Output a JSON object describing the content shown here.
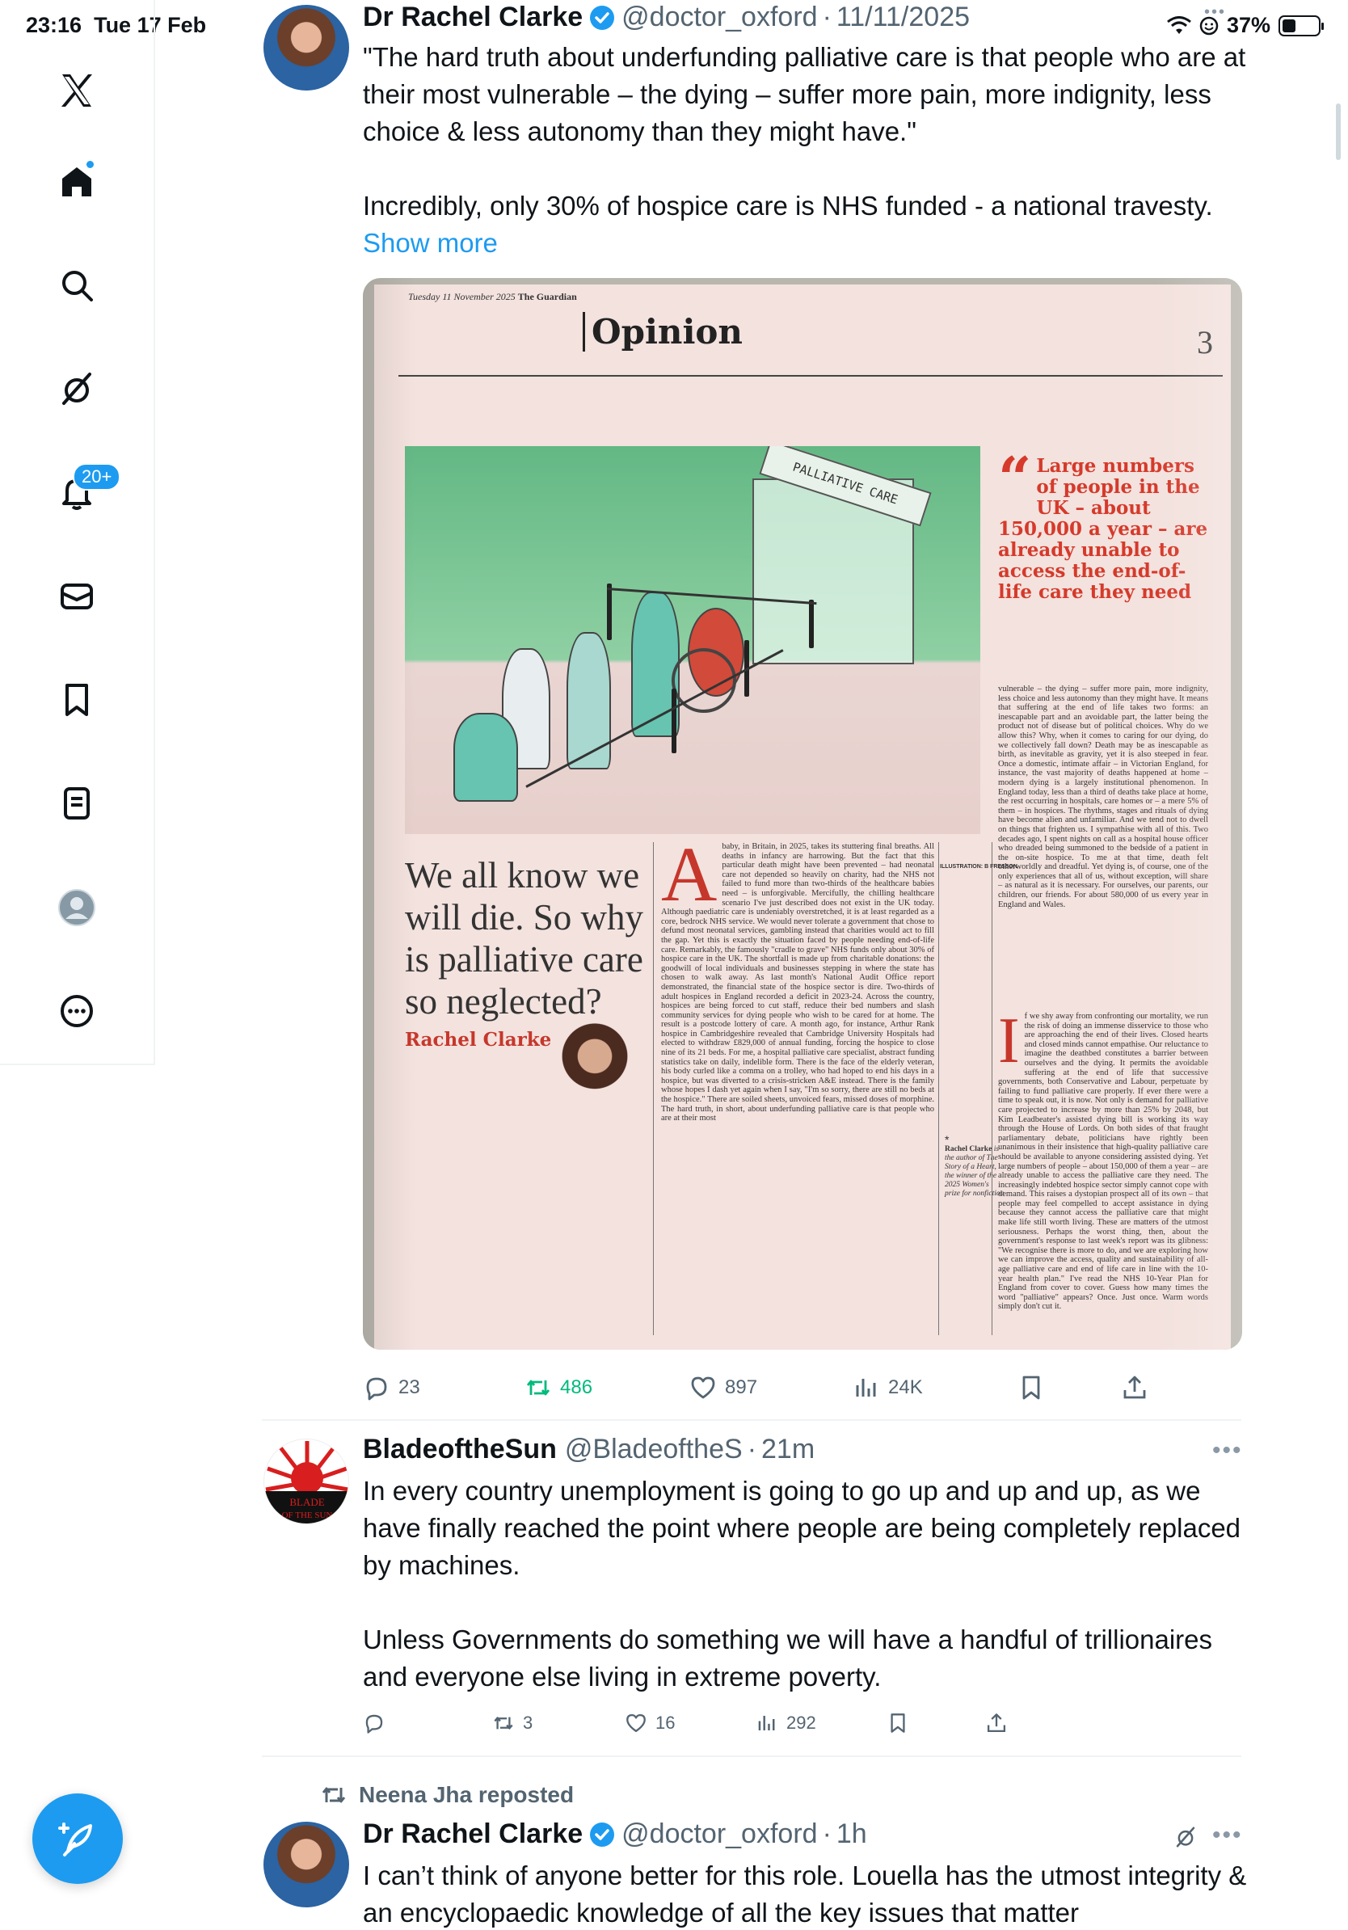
{
  "status_bar": {
    "time": "23:16",
    "date": "Tue 17 Feb",
    "battery": "37%",
    "battery_level": 0.37
  },
  "sidebar": {
    "items": [
      {
        "name": "x-logo-icon"
      },
      {
        "name": "home-icon"
      },
      {
        "name": "search-icon"
      },
      {
        "name": "grok-icon"
      },
      {
        "name": "notifications-icon"
      },
      {
        "name": "messages-icon"
      },
      {
        "name": "bookmarks-icon"
      },
      {
        "name": "lists-icon"
      },
      {
        "name": "profile-icon"
      },
      {
        "name": "more-icon"
      }
    ],
    "notifications_badge": "20+",
    "compose_icon": "compose-feather-icon"
  },
  "tweets": [
    {
      "author_name": "Dr Rachel Clarke",
      "handle": "@doctor_oxford",
      "separator": "·",
      "time": "11/11/2025",
      "text": "\"The hard truth about underfunding palliative care is that people who are at their most vulnerable – the dying – suffer more pain, more indignity, less choice & less autonomy than they might have.\"\n\nIncredibly, only 30% of hospice care is NHS funded - a national travesty.",
      "show_more": "Show more",
      "stats": {
        "replies": "23",
        "reposts": "486",
        "likes": "897",
        "views": "24K"
      }
    },
    {
      "author_name": "BladeoftheSun",
      "handle": "@BladeoftheS",
      "separator": "·",
      "time": "21m",
      "text": "In every country unemployment is going to go up and up and up, as we have finally reached the point where people are being completely replaced by machines.\n\nUnless Governments do something we will have a handful of trillionaires and everyone else living in extreme poverty.",
      "stats": {
        "replies": "",
        "reposts": "3",
        "likes": "16",
        "views": "292"
      },
      "avatar_text": "BLADE OF THE SUN"
    },
    {
      "repost_label": "Neena Jha reposted",
      "author_name": "Dr Rachel Clarke",
      "handle": "@doctor_oxford",
      "separator": "·",
      "time": "1h",
      "text": "I can’t think of anyone better for this role. Louella has the utmost integrity & an encyclopaedic knowledge of all the key issues that matter"
    }
  ],
  "newspaper": {
    "date": "Tuesday 11 November 2025",
    "paper": "The Guardian",
    "section": "Opinion",
    "page_number": "3",
    "sign_text": "PALLIATIVE CARE",
    "pull_quote": "Large numbers of people in the UK – about 150,000 a year – are already unable to access the end-of-life care they need",
    "headline": "We all know we will die. So why is palliative care so neglected?",
    "byline": "Rachel Clarke",
    "illustration_credit": "ILLUSTRATION: B FRESSON",
    "bio_name": "Rachel Clarke",
    "bio_text": "is the author of The Story of a Heart, the winner of the 2025 Women's prize for nonfiction",
    "col1": "baby, in Britain, in 2025, takes its stuttering final breaths. All deaths in infancy are harrowing. But the fact that this particular death might have been prevented – had neonatal care not depended so heavily on charity, had the NHS not failed to fund more than two-thirds of the healthcare babies need – is unforgivable. Mercifully, the chilling healthcare scenario I've just described does not exist in the UK today. Although paediatric care is undeniably overstretched, it is at least regarded as a core, bedrock NHS service. We would never tolerate a government that chose to defund most neonatal services, gambling instead that charities would act to fill the gap. Yet this is exactly the situation faced by people needing end-of-life care. Remarkably, the famously \"cradle to grave\" NHS funds only about 30% of hospice care in the UK. The shortfall is made up from charitable donations: the goodwill of local individuals and businesses stepping in where the state has chosen to walk away. As last month's National Audit Office report demonstrated, the financial state of the hospice sector is dire. Two-thirds of adult hospices in England recorded a deficit in 2023-24. Across the country, hospices are being forced to cut staff, reduce their bed numbers and slash community services for dying people who wish to be cared for at home. The result is a postcode lottery of care. A month ago, for instance, Arthur Rank hospice in Cambridgeshire revealed that Cambridge University Hospitals had elected to withdraw £829,000 of annual funding, forcing the hospice to close nine of its 21 beds. For me, a hospital palliative care specialist, abstract funding statistics take on daily, indelible form. There is the face of the elderly veteran, his body curled like a comma on a trolley, who had hoped to end his days in a hospice, but was diverted to a crisis-stricken A&E instead. There is the family whose hopes I dash yet again when I say, \"I'm so sorry, there are still no beds at the hospice.\" There are soiled sheets, unvoiced fears, missed doses of morphine. The hard truth, in short, about underfunding palliative care is that people who are at their most",
    "col2": "vulnerable – the dying – suffer more pain, more indignity, less choice and less autonomy than they might have. It means that suffering at the end of life takes two forms: an inescapable part and an avoidable part, the latter being the product not of disease but of political choices. Why do we allow this? Why, when it comes to caring for our dying, do we collectively fall down? Death may be as inescapable as birth, as inevitable as gravity, yet it is also steeped in fear. Once a domestic, intimate affair – in Victorian England, for instance, the vast majority of deaths happened at home – modern dying is a largely institutional phenomenon. In England today, less than a third of deaths take place at home, the rest occurring in hospitals, care homes or – a mere 5% of them – in hospices. The rhythms, stages and rituals of dying have become alien and unfamiliar. And we tend not to dwell on things that frighten us. I sympathise with all of this. Two decades ago, I spent nights on call as a hospital house officer who dreaded being summoned to the bedside of a patient in the on-site hospice. To me at that time, death felt otherworldly and dreadful. Yet dying is, of course, one of the only experiences that all of us, without exception, will share – as natural as it is necessary. For ourselves, our parents, our children, our friends. For about 580,000 of us every year in England and Wales.",
    "col3": "f we shy away from confronting our mortality, we run the risk of doing an immense disservice to those who are approaching the end of their lives. Closed hearts and closed minds cannot empathise. Our reluctance to imagine the deathbed constitutes a barrier between ourselves and the dying. It permits the avoidable suffering at the end of life that successive governments, both Conservative and Labour, perpetuate by failing to fund palliative care properly. If ever there were a time to speak out, it is now. Not only is demand for palliative care projected to increase by more than 25% by 2048, but Kim Leadbeater's assisted dying bill is working its way through the House of Lords. On both sides of that fraught parliamentary debate, politicians have rightly been unanimous in their insistence that high-quality palliative care should be available to anyone considering assisted dying. Yet large numbers of people – about 150,000 of them a year – are already unable to access the palliative care they need. The increasingly indebted hospice sector simply cannot cope with demand. This raises a dystopian prospect all of its own – that people may feel compelled to accept assistance in dying because they cannot access the palliative care that might make life still worth living. These are matters of the utmost seriousness. Perhaps the worst thing, then, about the government's response to last week's report was its glibness: \"We recognise there is more to do, and we are exploring how we can improve the access, quality and sustainability of all-age palliative care and end of life care in line with the 10-year health plan.\" I've read the NHS 10-Year Plan for England from cover to cover. Guess how many times the word \"palliative\" appears? Once. Just once. Warm words simply don't cut it."
  },
  "colors": {
    "accent": "#1d9bf0",
    "retweet": "#00ba7c",
    "muted": "#536471",
    "guardian_red": "#c6372b"
  }
}
